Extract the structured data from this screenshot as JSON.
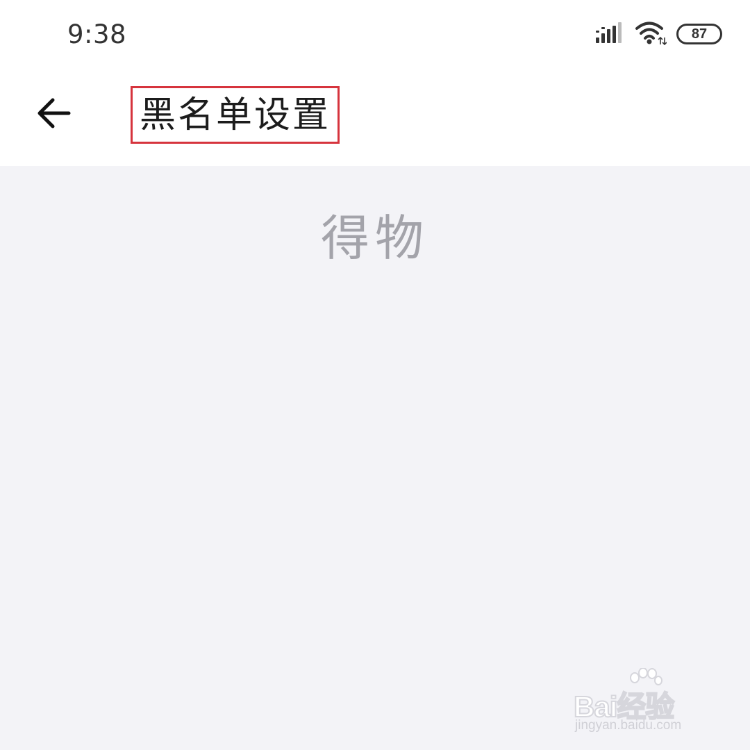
{
  "status_bar": {
    "time": "9:38",
    "battery_level": "87",
    "icons": [
      "signal-icon",
      "wifi-icon",
      "battery-icon"
    ]
  },
  "toolbar": {
    "back_icon": "arrow-left-icon",
    "title": "黑名单设置",
    "highlight_color": "#d6343d"
  },
  "content": {
    "watermark_logo": "得物"
  },
  "watermark": {
    "brand": "Bai经验",
    "site": "jingyan.baidu.com"
  },
  "colors": {
    "background": "#f3f3f7",
    "toolbar": "#ffffff",
    "text": "#1c1c1c"
  }
}
